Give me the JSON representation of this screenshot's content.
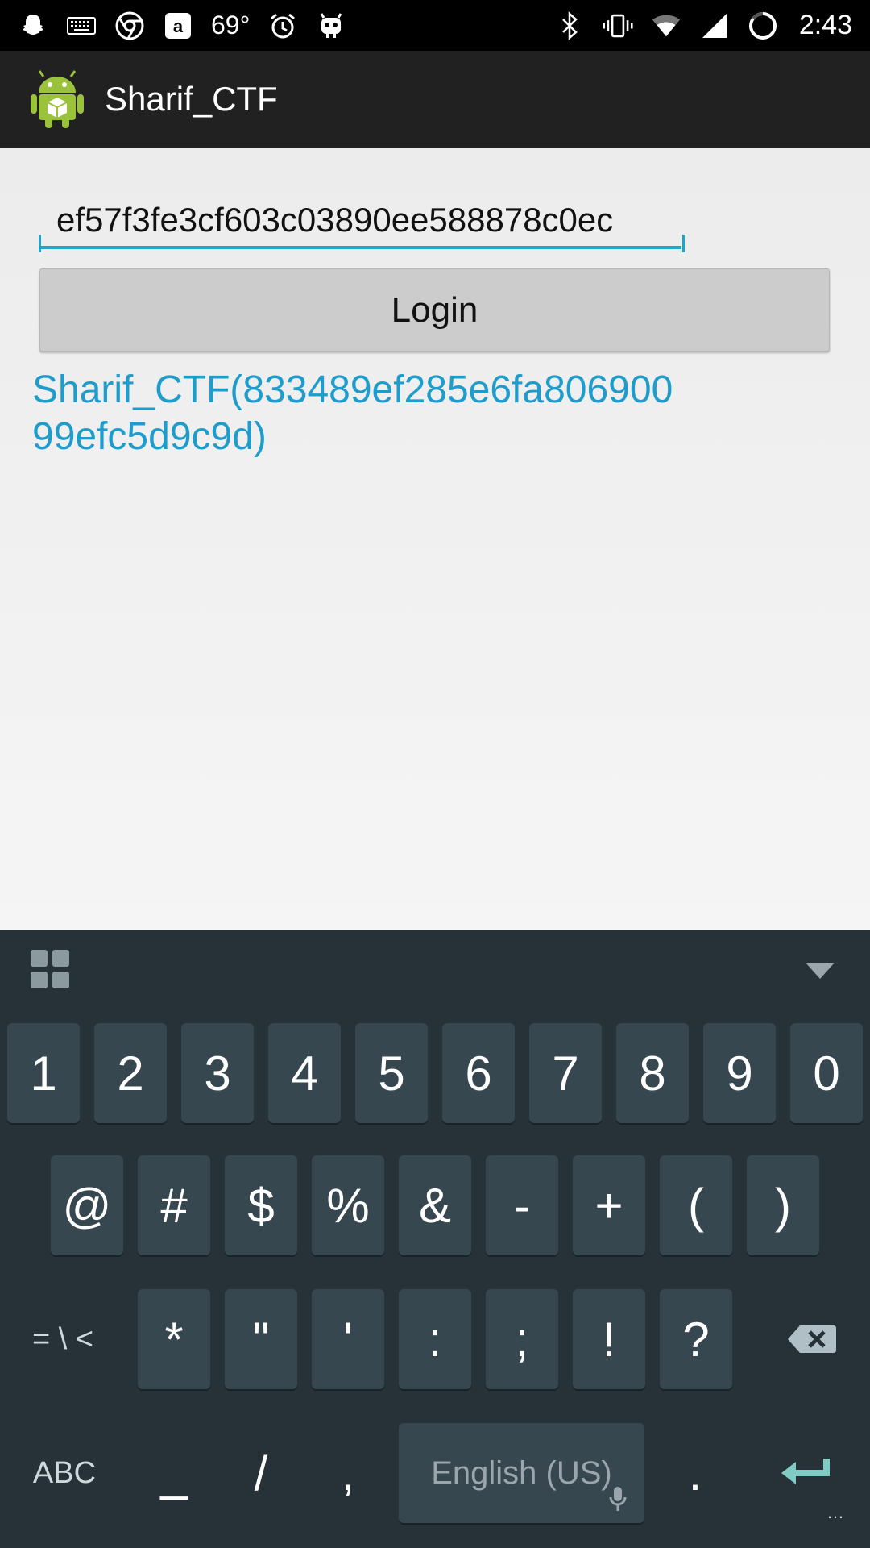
{
  "status_bar": {
    "temperature": "69°",
    "time": "2:43",
    "left_icons": [
      "snapchat-icon",
      "keyboard-icon",
      "chrome-icon",
      "amazon-icon",
      "alarm-icon",
      "cyanogen-icon"
    ],
    "right_icons": [
      "bluetooth-icon",
      "vibrate-icon",
      "wifi-icon",
      "signal-icon",
      "battery-icon"
    ]
  },
  "action_bar": {
    "title": "Sharif_CTF"
  },
  "form": {
    "input_value": "ef57f3fe3cf603c03890ee588878c0ec",
    "login_label": "Login",
    "result": "Sharif_CTF(833489ef285e6fa80690099efc5d9c9d)"
  },
  "keyboard": {
    "row1": [
      "1",
      "2",
      "3",
      "4",
      "5",
      "6",
      "7",
      "8",
      "9",
      "0"
    ],
    "row2": [
      "@",
      "#",
      "$",
      "%",
      "&",
      "-",
      "+",
      "(",
      ")"
    ],
    "row3_left": "= \\ <",
    "row3": [
      "*",
      "\"",
      "'",
      ":",
      ";",
      "!",
      "?"
    ],
    "row4_left": "ABC",
    "row4": [
      "_",
      "/",
      ","
    ],
    "space_label": "English (US)",
    "period": ".",
    "colors": {
      "background": "#263238",
      "key": "#37474f",
      "enter": "#80cbc4"
    }
  },
  "colors": {
    "accent": "#1e9ccc",
    "status_bar": "#000000",
    "action_bar": "#212121"
  }
}
